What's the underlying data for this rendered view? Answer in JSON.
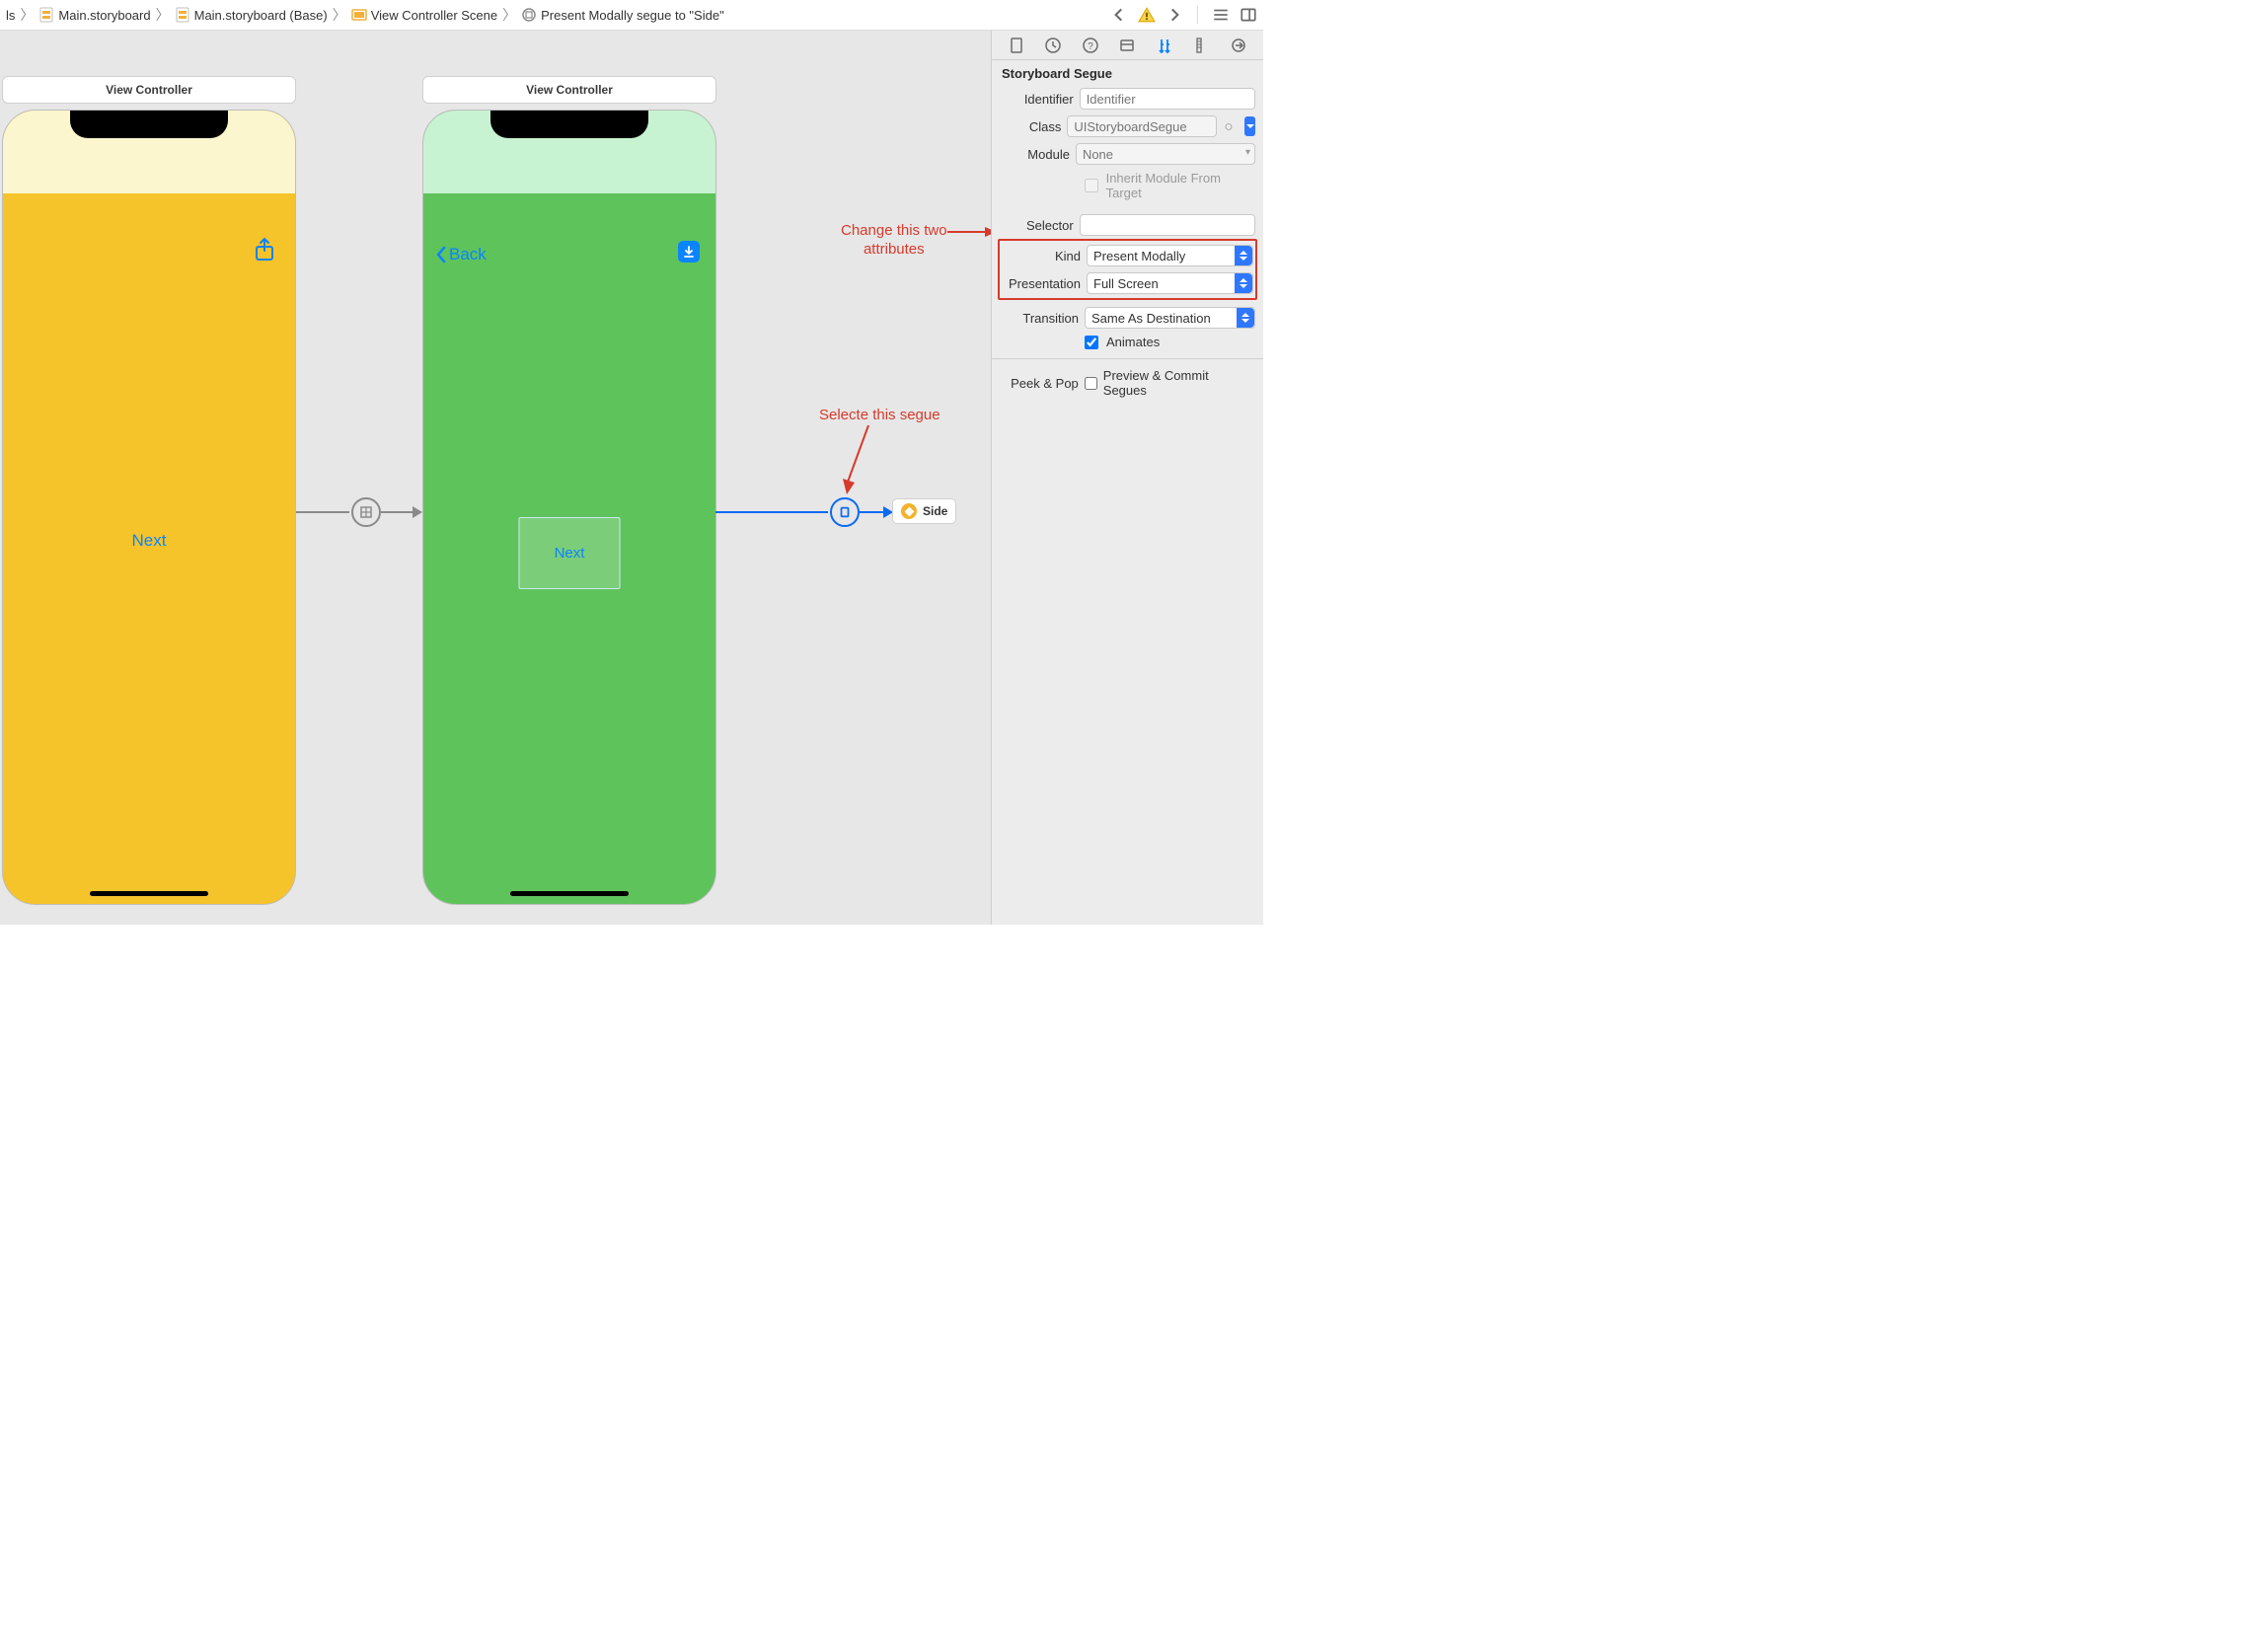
{
  "breadcrumbs": {
    "stub": "ls",
    "items": [
      {
        "label": "Main.storyboard"
      },
      {
        "label": "Main.storyboard (Base)"
      },
      {
        "label": "View Controller Scene"
      },
      {
        "label": "Present Modally segue to \"Side\""
      }
    ]
  },
  "canvas": {
    "vc1": {
      "title": "View Controller",
      "next_label": "Next"
    },
    "vc2": {
      "title": "View Controller",
      "back_label": "Back",
      "container_label": "Next"
    },
    "side_chip": "Side"
  },
  "annotations": {
    "segue": "Selecte this segue",
    "attrs_line1": "Change this two",
    "attrs_line2": "attributes"
  },
  "inspector": {
    "section_title": "Storyboard Segue",
    "labels": {
      "identifier": "Identifier",
      "class": "Class",
      "module": "Module",
      "inherit": "Inherit Module From Target",
      "selector": "Selector",
      "kind": "Kind",
      "presentation": "Presentation",
      "transition": "Transition",
      "animates": "Animates",
      "peekpop": "Peek & Pop",
      "peekpop_value": "Preview & Commit Segues"
    },
    "values": {
      "identifier_placeholder": "Identifier",
      "class_placeholder": "UIStoryboardSegue",
      "module_placeholder": "None",
      "kind": "Present Modally",
      "presentation": "Full Screen",
      "transition": "Same As Destination"
    }
  }
}
